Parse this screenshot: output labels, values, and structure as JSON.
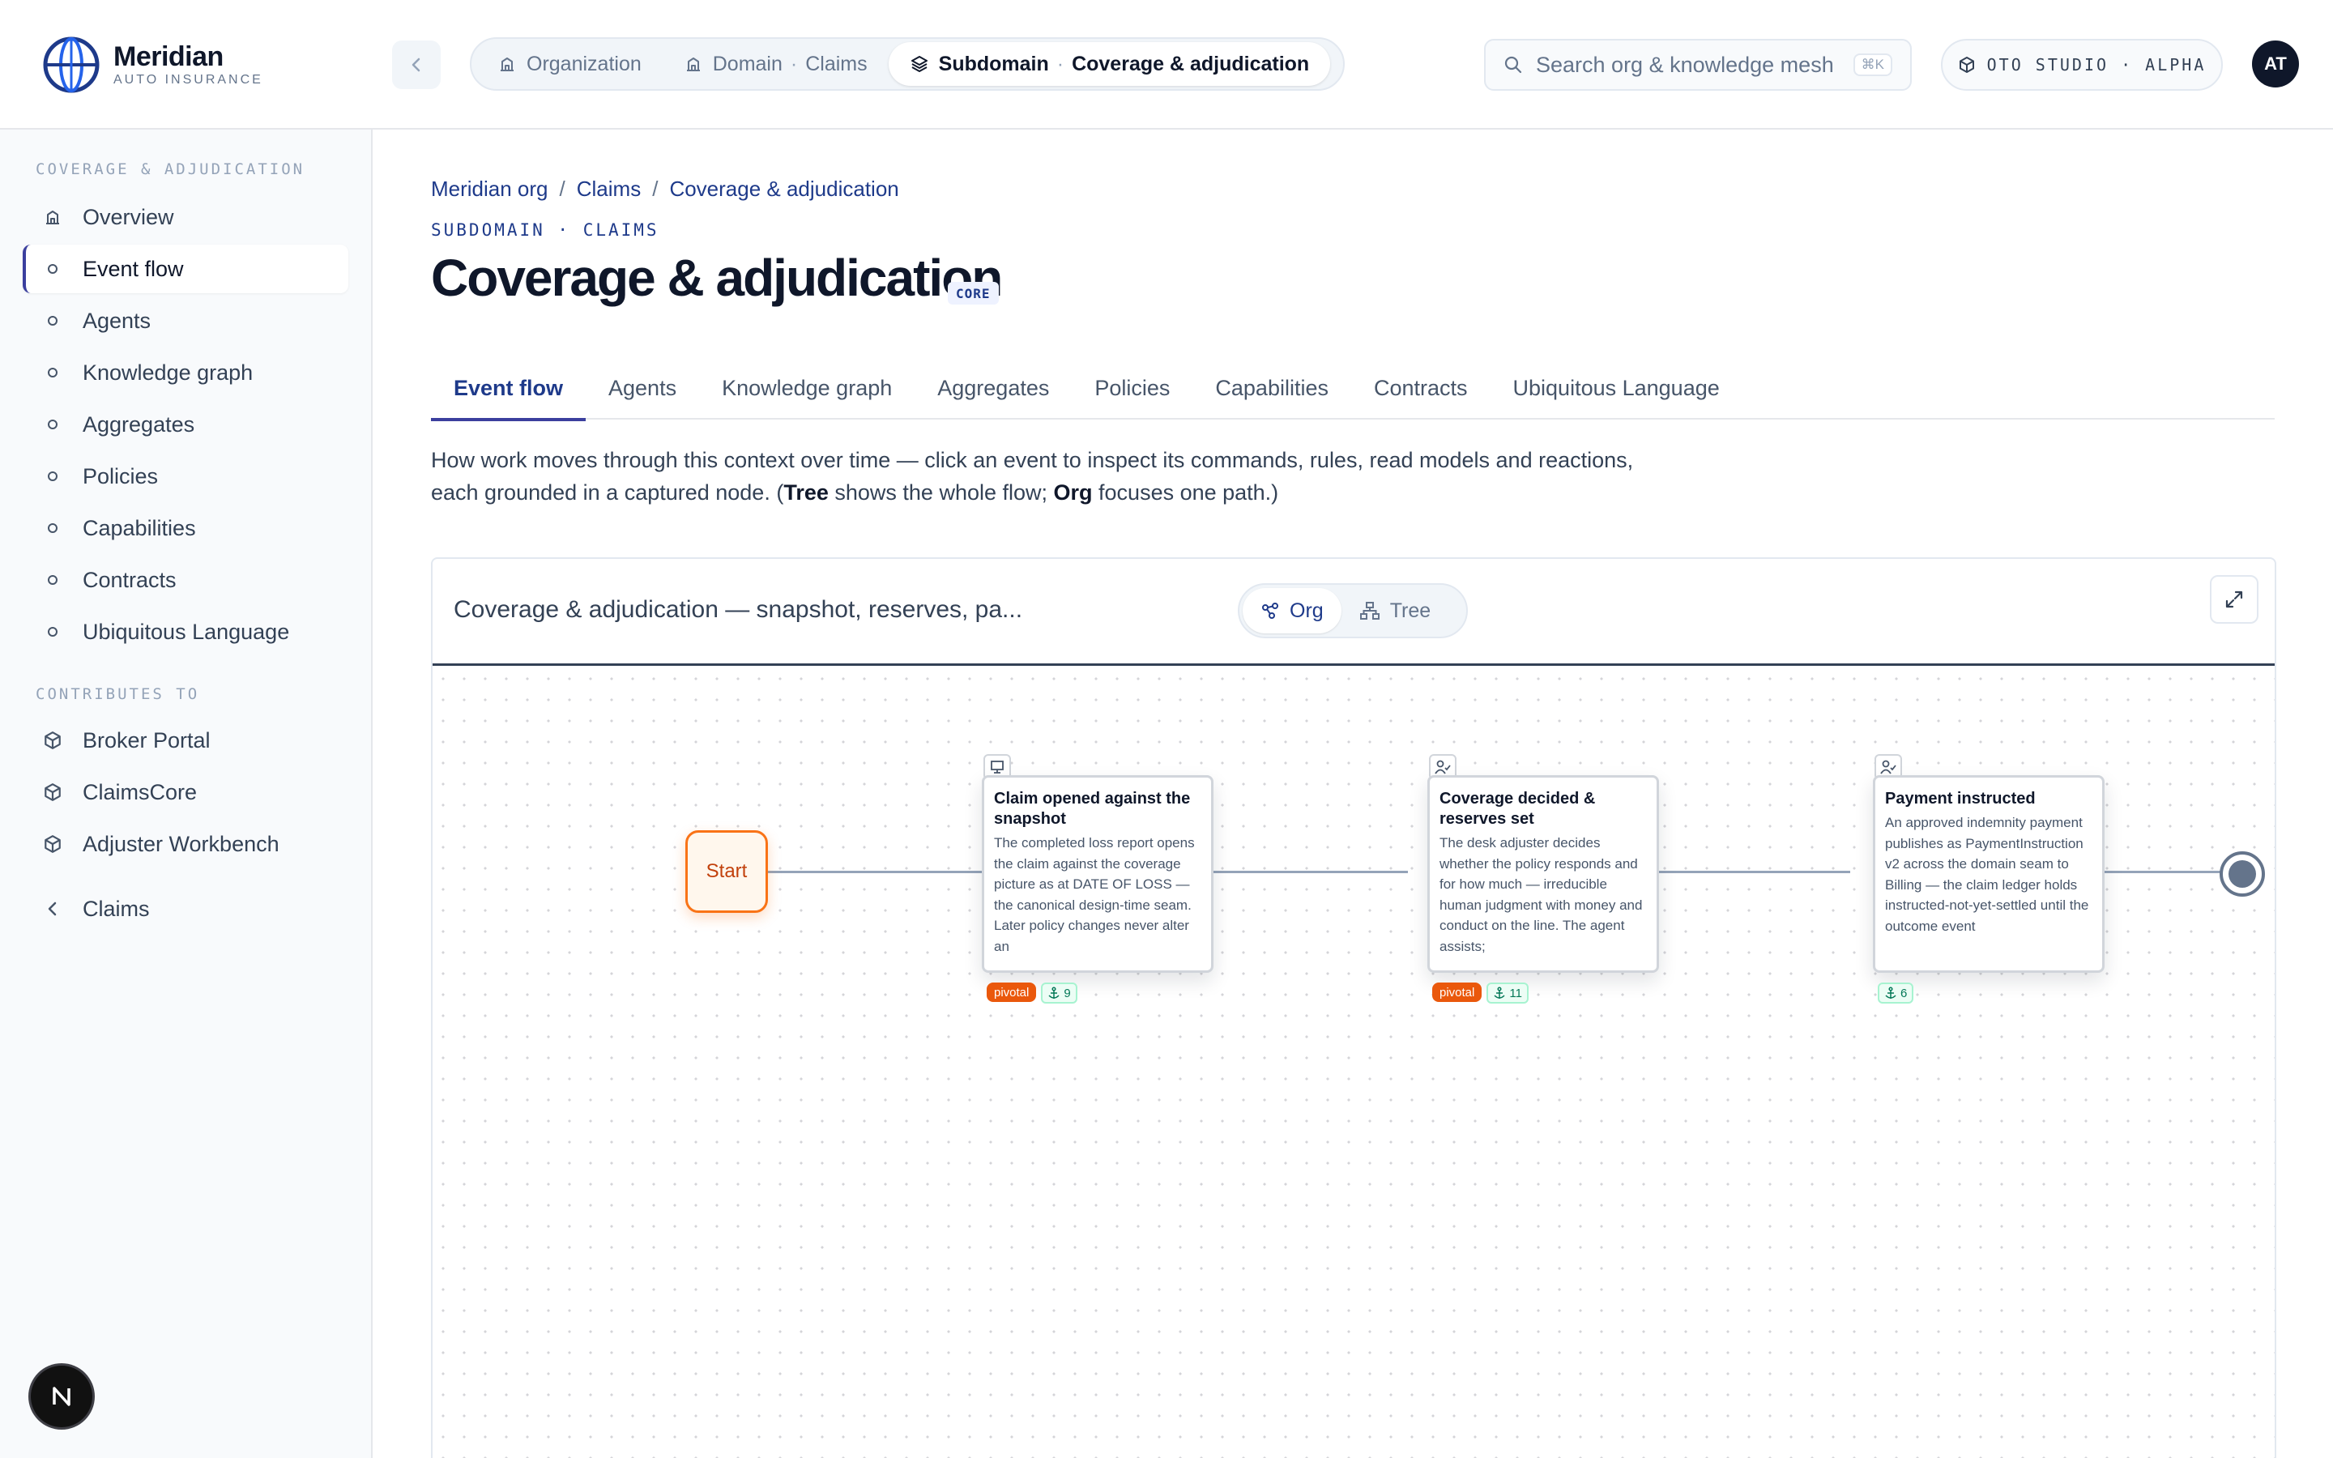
{
  "brand": {
    "name": "Meridian",
    "sub": "AUTO INSURANCE"
  },
  "topnav": {
    "org": "Organization",
    "domain_label": "Domain",
    "domain_value": "Claims",
    "subdomain_label": "Subdomain",
    "subdomain_value": "Coverage & adjudication",
    "separator": "·"
  },
  "search": {
    "placeholder": "Search org & knowledge mesh",
    "shortcut": "⌘K"
  },
  "studio": "OTO STUDIO · ALPHA",
  "avatar": "AT",
  "sidebar": {
    "section1": "COVERAGE & ADJUDICATION",
    "items": [
      "Overview",
      "Event flow",
      "Agents",
      "Knowledge graph",
      "Aggregates",
      "Policies",
      "Capabilities",
      "Contracts",
      "Ubiquitous Language"
    ],
    "section2": "CONTRIBUTES TO",
    "contributes": [
      "Broker Portal",
      "ClaimsCore",
      "Adjuster Workbench"
    ],
    "back": "Claims"
  },
  "breadcrumb": [
    "Meridian org",
    "Claims",
    "Coverage & adjudication"
  ],
  "breadcrumb_sep": "/",
  "kicker": "SUBDOMAIN · CLAIMS",
  "title": "Coverage & adjudication",
  "badge": "CORE",
  "tabs": [
    "Event flow",
    "Agents",
    "Knowledge graph",
    "Aggregates",
    "Policies",
    "Capabilities",
    "Contracts",
    "Ubiquitous Language"
  ],
  "description": {
    "part1": "How work moves through this context over time — click an event to inspect its commands, rules, read models and reactions, each grounded in a captured node. (",
    "tree": "Tree",
    "part2": " shows the whole flow; ",
    "org": "Org",
    "part3": " focuses one path.)"
  },
  "flow": {
    "title": "Coverage & adjudication — snapshot, reserves, pa...",
    "toggle_org": "Org",
    "toggle_tree": "Tree",
    "start": "Start",
    "nodes": [
      {
        "title": "Claim opened against the snapshot",
        "body": "The completed loss report opens the claim against the coverage picture as at DATE OF LOSS — the canonical design-time seam. Later policy changes never alter an",
        "icon": "monitor-icon",
        "pivotal": "pivotal",
        "anchors": "9"
      },
      {
        "title": "Coverage decided & reserves set",
        "body": "The desk adjuster decides whether the policy responds and for how much — irreducible human judgment with money and conduct on the line. The agent assists;",
        "icon": "user-check-icon",
        "pivotal": "pivotal",
        "anchors": "11"
      },
      {
        "title": "Payment instructed",
        "body": "An approved indemnity payment publishes as PaymentInstruction v2 across the domain seam to Billing — the claim ledger holds instructed-not-yet-settled until the outcome event",
        "icon": "user-check-icon",
        "pivotal": "",
        "anchors": "6"
      }
    ]
  },
  "colors": {
    "accent": "#1e3a8a",
    "pivotal": "#ea580c",
    "start": "#f97316"
  }
}
